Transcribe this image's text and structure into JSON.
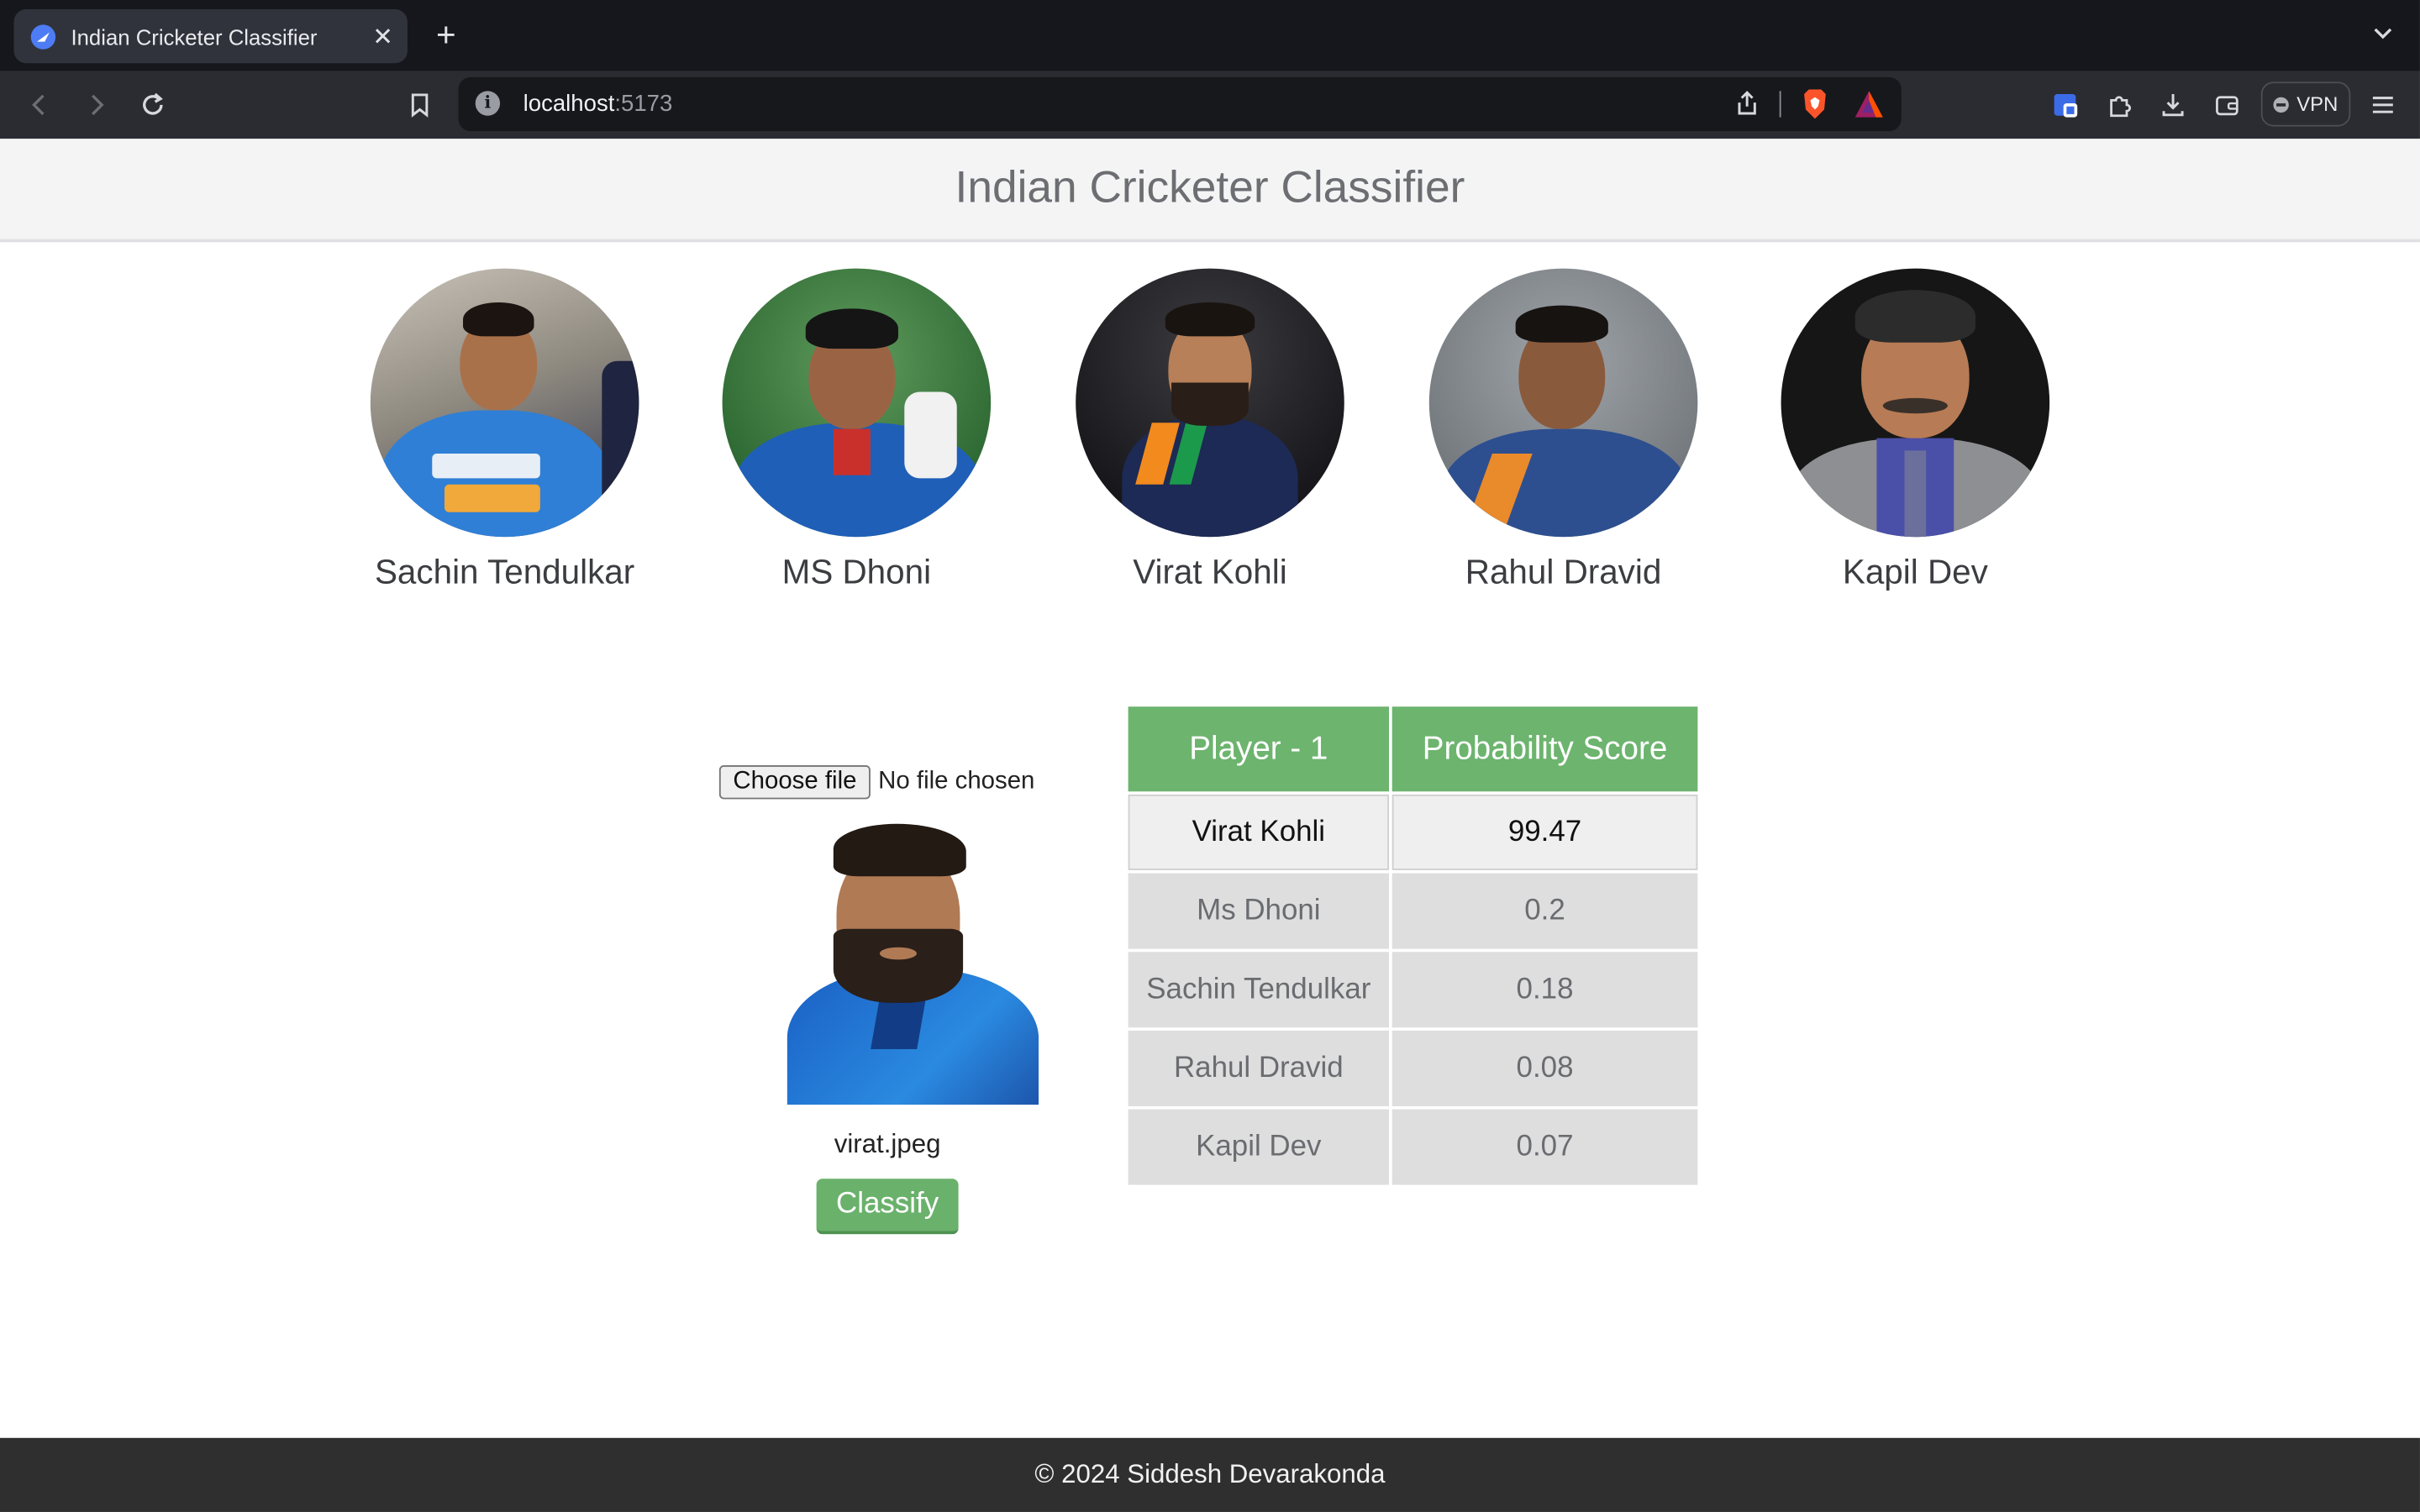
{
  "browser": {
    "tab_title": "Indian Cricketer Classifier",
    "url_host": "localhost",
    "url_port": ":5173",
    "vpn_label": "VPN"
  },
  "header": {
    "title": "Indian Cricketer Classifier"
  },
  "players": [
    {
      "name": "Sachin Tendulkar"
    },
    {
      "name": "MS Dhoni"
    },
    {
      "name": "Virat Kohli"
    },
    {
      "name": "Rahul Dravid"
    },
    {
      "name": "Kapil Dev"
    }
  ],
  "upload": {
    "choose_label": "Choose file",
    "status": "No file chosen",
    "filename": "virat.jpeg",
    "classify_label": "Classify"
  },
  "results": {
    "headers": [
      "Player - 1",
      "Probability Score"
    ],
    "rows": [
      {
        "player": "Virat Kohli",
        "score": "99.47"
      },
      {
        "player": "Ms Dhoni",
        "score": "0.2"
      },
      {
        "player": "Sachin Tendulkar",
        "score": "0.18"
      },
      {
        "player": "Rahul Dravid",
        "score": "0.08"
      },
      {
        "player": "Kapil Dev",
        "score": "0.07"
      }
    ]
  },
  "footer": {
    "text": "© 2024 Siddesh Devarakonda"
  },
  "colors": {
    "accent_green": "#6db46f",
    "footer_bg": "#2f2f2f",
    "header_bg": "#f4f4f5"
  }
}
